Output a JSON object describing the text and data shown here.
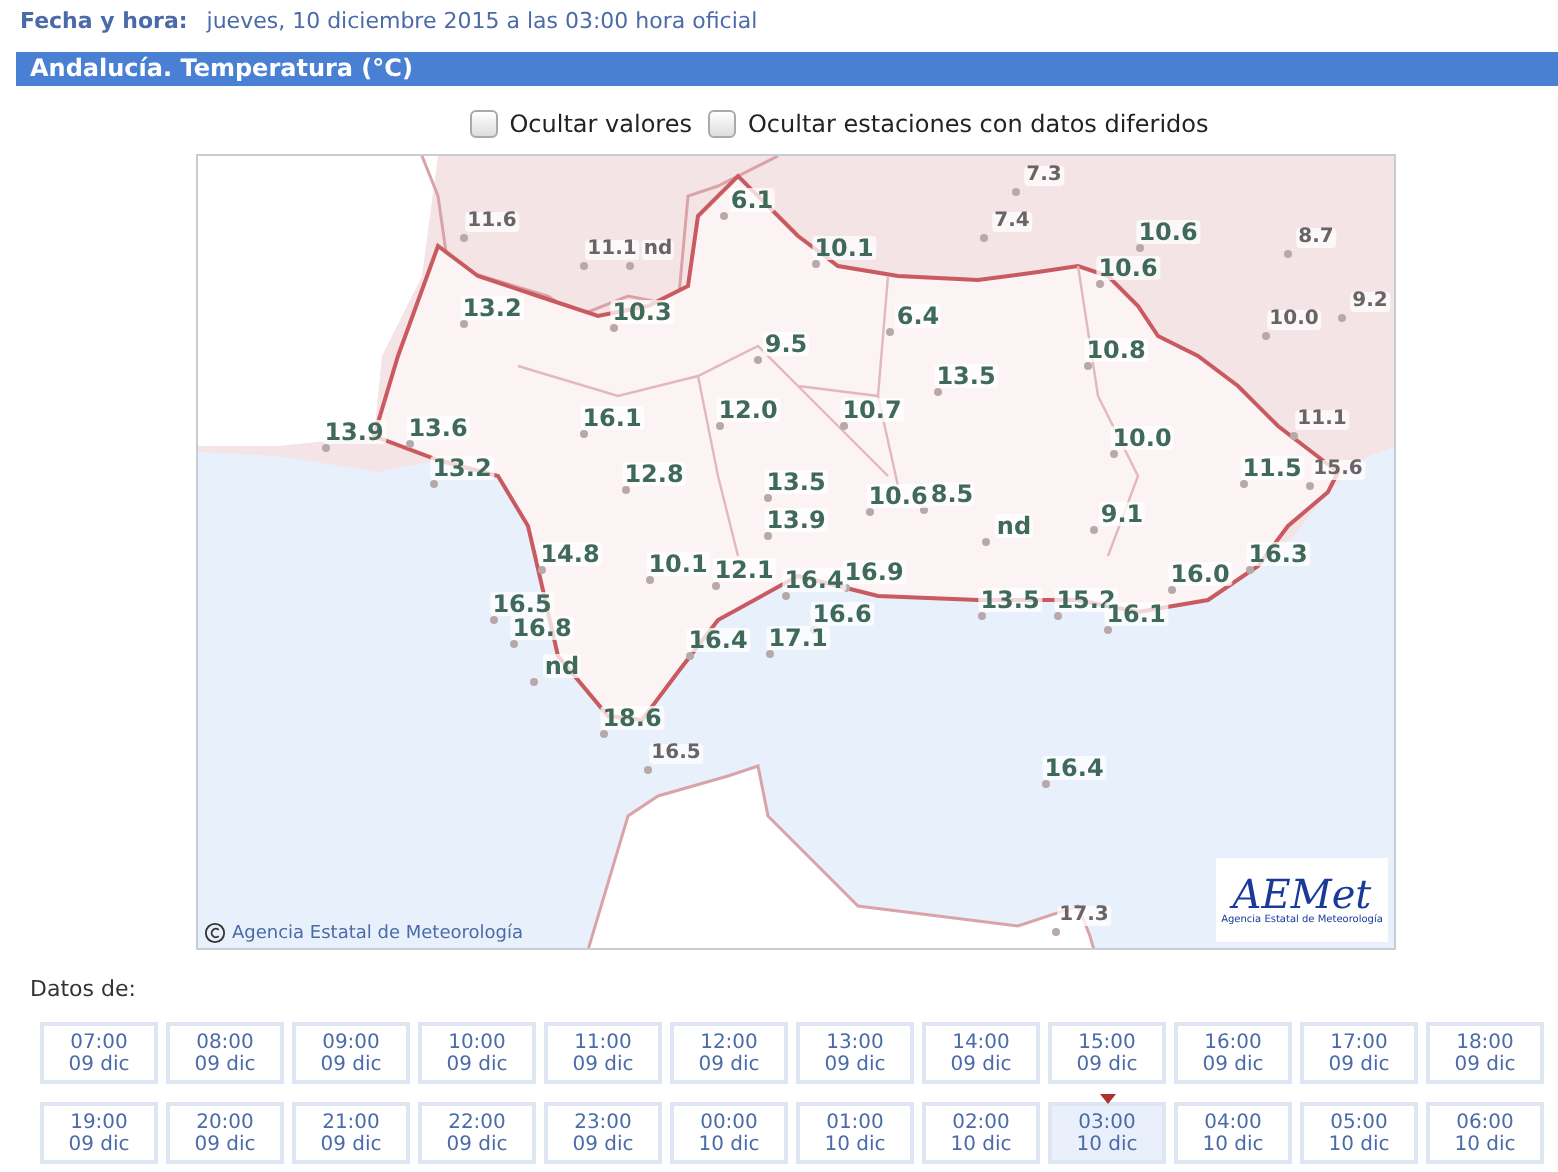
{
  "header": {
    "date_label": "Fecha y hora:",
    "date_value": "jueves, 10 diciembre 2015 a las 03:00 hora oficial"
  },
  "section_title": "Andalucía. Temperatura (°C)",
  "options": [
    {
      "label": "Ocultar valores",
      "checked": false
    },
    {
      "label": "Ocultar estaciones con datos diferidos",
      "checked": false
    }
  ],
  "map": {
    "credit": "Agencia Estatal de Meteorología",
    "logo_name": "AEMet",
    "logo_subtitle": "Agencia Estatal de Meteorología",
    "stations": [
      {
        "value": "7.3",
        "kind": "outside"
      },
      {
        "value": "6.1",
        "kind": "region"
      },
      {
        "value": "11.6",
        "kind": "outside"
      },
      {
        "value": "11.1",
        "kind": "outside"
      },
      {
        "value": "nd",
        "kind": "outside"
      },
      {
        "value": "10.1",
        "kind": "region"
      },
      {
        "value": "7.4",
        "kind": "outside"
      },
      {
        "value": "10.6",
        "kind": "region"
      },
      {
        "value": "8.7",
        "kind": "outside"
      },
      {
        "value": "10.6",
        "kind": "region"
      },
      {
        "value": "13.2",
        "kind": "region"
      },
      {
        "value": "10.3",
        "kind": "region"
      },
      {
        "value": "6.4",
        "kind": "region"
      },
      {
        "value": "10.0",
        "kind": "outside"
      },
      {
        "value": "9.2",
        "kind": "outside"
      },
      {
        "value": "9.5",
        "kind": "region"
      },
      {
        "value": "10.8",
        "kind": "region"
      },
      {
        "value": "13.5",
        "kind": "region"
      },
      {
        "value": "13.9",
        "kind": "region"
      },
      {
        "value": "13.6",
        "kind": "region"
      },
      {
        "value": "16.1",
        "kind": "region"
      },
      {
        "value": "12.0",
        "kind": "region"
      },
      {
        "value": "10.7",
        "kind": "region"
      },
      {
        "value": "10.0",
        "kind": "region"
      },
      {
        "value": "11.1",
        "kind": "outside"
      },
      {
        "value": "13.2",
        "kind": "region"
      },
      {
        "value": "12.8",
        "kind": "region"
      },
      {
        "value": "13.5",
        "kind": "region"
      },
      {
        "value": "11.5",
        "kind": "region"
      },
      {
        "value": "15.6",
        "kind": "outside"
      },
      {
        "value": "10.6",
        "kind": "region"
      },
      {
        "value": "8.5",
        "kind": "region"
      },
      {
        "value": "13.9",
        "kind": "region"
      },
      {
        "value": "nd",
        "kind": "region"
      },
      {
        "value": "9.1",
        "kind": "region"
      },
      {
        "value": "14.8",
        "kind": "region"
      },
      {
        "value": "10.1",
        "kind": "region"
      },
      {
        "value": "12.1",
        "kind": "region"
      },
      {
        "value": "16.4",
        "kind": "region"
      },
      {
        "value": "16.9",
        "kind": "region"
      },
      {
        "value": "16.0",
        "kind": "region"
      },
      {
        "value": "16.3",
        "kind": "region"
      },
      {
        "value": "16.5",
        "kind": "region"
      },
      {
        "value": "16.8",
        "kind": "region"
      },
      {
        "value": "16.6",
        "kind": "region"
      },
      {
        "value": "13.5",
        "kind": "region"
      },
      {
        "value": "15.2",
        "kind": "region"
      },
      {
        "value": "16.1",
        "kind": "region"
      },
      {
        "value": "16.4",
        "kind": "region"
      },
      {
        "value": "17.1",
        "kind": "region"
      },
      {
        "value": "nd",
        "kind": "region"
      },
      {
        "value": "18.6",
        "kind": "region"
      },
      {
        "value": "16.5",
        "kind": "outside"
      },
      {
        "value": "16.4",
        "kind": "region"
      },
      {
        "value": "17.3",
        "kind": "outside"
      }
    ]
  },
  "data_from_label": "Datos de:",
  "time_slots": [
    {
      "time": "07:00",
      "day": "09 dic",
      "selected": false
    },
    {
      "time": "08:00",
      "day": "09 dic",
      "selected": false
    },
    {
      "time": "09:00",
      "day": "09 dic",
      "selected": false
    },
    {
      "time": "10:00",
      "day": "09 dic",
      "selected": false
    },
    {
      "time": "11:00",
      "day": "09 dic",
      "selected": false
    },
    {
      "time": "12:00",
      "day": "09 dic",
      "selected": false
    },
    {
      "time": "13:00",
      "day": "09 dic",
      "selected": false
    },
    {
      "time": "14:00",
      "day": "09 dic",
      "selected": false
    },
    {
      "time": "15:00",
      "day": "09 dic",
      "selected": false
    },
    {
      "time": "16:00",
      "day": "09 dic",
      "selected": false
    },
    {
      "time": "17:00",
      "day": "09 dic",
      "selected": false
    },
    {
      "time": "18:00",
      "day": "09 dic",
      "selected": false
    },
    {
      "time": "19:00",
      "day": "09 dic",
      "selected": false
    },
    {
      "time": "20:00",
      "day": "09 dic",
      "selected": false
    },
    {
      "time": "21:00",
      "day": "09 dic",
      "selected": false
    },
    {
      "time": "22:00",
      "day": "09 dic",
      "selected": false
    },
    {
      "time": "23:00",
      "day": "09 dic",
      "selected": false
    },
    {
      "time": "00:00",
      "day": "10 dic",
      "selected": false
    },
    {
      "time": "01:00",
      "day": "10 dic",
      "selected": false
    },
    {
      "time": "02:00",
      "day": "10 dic",
      "selected": false
    },
    {
      "time": "03:00",
      "day": "10 dic",
      "selected": true
    },
    {
      "time": "04:00",
      "day": "10 dic",
      "selected": false
    },
    {
      "time": "05:00",
      "day": "10 dic",
      "selected": false
    },
    {
      "time": "06:00",
      "day": "10 dic",
      "selected": false
    }
  ]
}
